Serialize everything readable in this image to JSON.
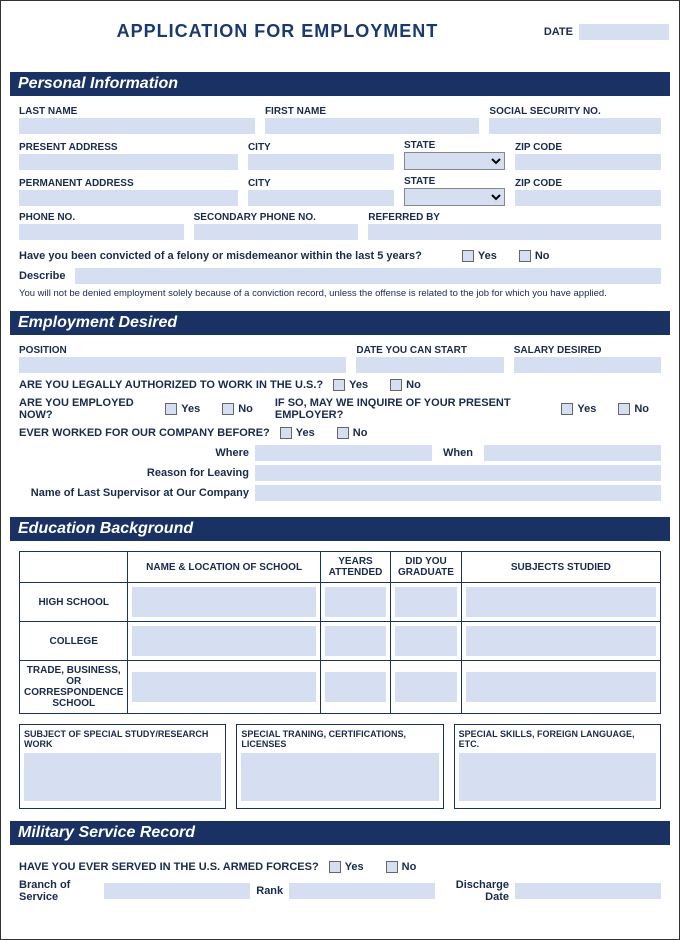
{
  "header": {
    "title": "APPLICATION FOR EMPLOYMENT",
    "date_label": "DATE"
  },
  "sections": {
    "personal": {
      "title": "Personal Information",
      "last_name": "LAST NAME",
      "first_name": "FIRST NAME",
      "ssn": "SOCIAL SECURITY NO.",
      "present_address": "PRESENT ADDRESS",
      "city": "CITY",
      "state": "STATE",
      "zip": "ZIP CODE",
      "permanent_address": "PERMANENT ADDRESS",
      "phone": "PHONE NO.",
      "phone2": "SECONDARY PHONE NO.",
      "referred": "REFERRED BY",
      "felony_q": "Have you been convicted of a felony or misdemeanor within the last 5 years?",
      "yes": "Yes",
      "no": "No",
      "describe": "Describe",
      "disclaimer": "You will not be denied employment solely because of a conviction record, unless the offense is related to the job for which you have applied."
    },
    "employment": {
      "title": "Employment Desired",
      "position": "POSITION",
      "start_date": "DATE YOU CAN START",
      "salary": "SALARY DESIRED",
      "authorized_q": "ARE YOU LEGALLY AUTHORIZED TO WORK IN THE U.S.?",
      "employed_q": "ARE YOU EMPLOYED NOW?",
      "inquire_q": "IF SO, MAY WE INQUIRE OF YOUR PRESENT EMPLOYER?",
      "prior_q": "EVER WORKED FOR OUR COMPANY BEFORE?",
      "where": "Where",
      "when": "When",
      "reason": "Reason for Leaving",
      "supervisor": "Name of Last Supervisor at Our Company",
      "yes": "Yes",
      "no": "No"
    },
    "education": {
      "title": "Education Background",
      "cols": {
        "c0": "",
        "c1": "NAME & LOCATION OF SCHOOL",
        "c2": "YEARS ATTENDED",
        "c3": "DID YOU GRADUATE",
        "c4": "SUBJECTS STUDIED"
      },
      "rows": {
        "r1": "HIGH SCHOOL",
        "r2": "COLLEGE",
        "r3": "TRADE, BUSINESS, OR CORRESPONDENCE SCHOOL"
      },
      "box1": "SUBJECT OF SPECIAL STUDY/RESEARCH WORK",
      "box2": "SPECIAL TRANING, CERTIFICATIONS, LICENSES",
      "box3": "SPECIAL SKILLS, FOREIGN LANGUAGE, ETC."
    },
    "military": {
      "title": "Military Service Record",
      "served_q": "HAVE YOU EVER SERVED IN THE U.S. ARMED FORCES?",
      "yes": "Yes",
      "no": "No",
      "branch": "Branch of Service",
      "rank": "Rank",
      "discharge": "Discharge Date"
    }
  }
}
